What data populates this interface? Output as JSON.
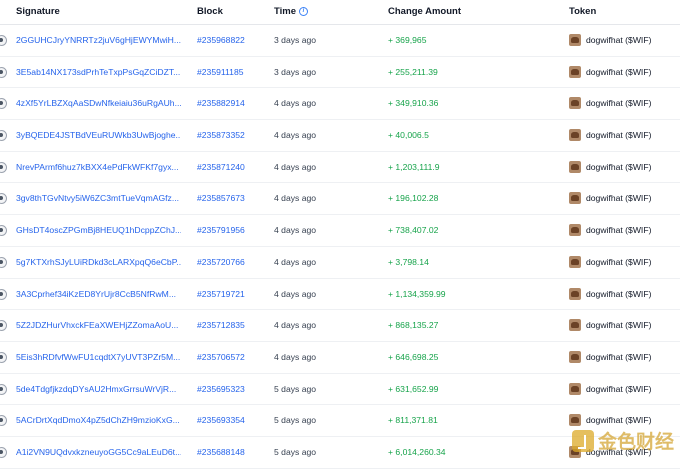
{
  "header": {
    "signature": "Signature",
    "block": "Block",
    "time": "Time",
    "change_amount": "Change Amount",
    "token": "Token"
  },
  "rows": [
    {
      "signature": "2GGUHCJryYNRRTz2juV6gHjEWYMwiH...",
      "block": "#235968822",
      "time": "3 days ago",
      "change": "+ 369,965",
      "token": "dogwifhat ($WIF)"
    },
    {
      "signature": "3E5ab14NX173sdPrhTeTxpPsGqZCiDZT...",
      "block": "#235911185",
      "time": "3 days ago",
      "change": "+ 255,211.39",
      "token": "dogwifhat ($WIF)"
    },
    {
      "signature": "4zXf5YrLBZXqAaSDwNfkeiaiu36uRgAUh...",
      "block": "#235882914",
      "time": "4 days ago",
      "change": "+ 349,910.36",
      "token": "dogwifhat ($WIF)"
    },
    {
      "signature": "3yBQEDE4JSTBdVEuRUWkb3UwBjoghe...",
      "block": "#235873352",
      "time": "4 days ago",
      "change": "+ 40,006.5",
      "token": "dogwifhat ($WIF)"
    },
    {
      "signature": "NrevPArmf6huz7kBXX4ePdFkWFKf7gyx...",
      "block": "#235871240",
      "time": "4 days ago",
      "change": "+ 1,203,111.9",
      "token": "dogwifhat ($WIF)"
    },
    {
      "signature": "3gv8thTGvNtvy5iW6ZC3mtTueVqmAGfz...",
      "block": "#235857673",
      "time": "4 days ago",
      "change": "+ 196,102.28",
      "token": "dogwifhat ($WIF)"
    },
    {
      "signature": "GHsDT4oscZPGmBj8HEUQ1hDcppZChJ...",
      "block": "#235791956",
      "time": "4 days ago",
      "change": "+ 738,407.02",
      "token": "dogwifhat ($WIF)"
    },
    {
      "signature": "5g7KTXrhSJyLUiRDkd3cLARXpqQ6eCbP...",
      "block": "#235720766",
      "time": "4 days ago",
      "change": "+ 3,798.14",
      "token": "dogwifhat ($WIF)"
    },
    {
      "signature": "3A3Cprhef34iKzED8YrUjr8CcB5NfRwM...",
      "block": "#235719721",
      "time": "4 days ago",
      "change": "+ 1,134,359.99",
      "token": "dogwifhat ($WIF)"
    },
    {
      "signature": "5Z2JDZHurVhxckFEaXWEHjZZomaAoU...",
      "block": "#235712835",
      "time": "4 days ago",
      "change": "+ 868,135.27",
      "token": "dogwifhat ($WIF)"
    },
    {
      "signature": "5Eis3hRDfvfWwFU1cqdtX7yUVT3PZr5M...",
      "block": "#235706572",
      "time": "4 days ago",
      "change": "+ 646,698.25",
      "token": "dogwifhat ($WIF)"
    },
    {
      "signature": "5de4TdgfjkzdqDYsAU2HmxGrrsuWrVjR...",
      "block": "#235695323",
      "time": "5 days ago",
      "change": "+ 631,652.99",
      "token": "dogwifhat ($WIF)"
    },
    {
      "signature": "5ACrDrtXqdDmoX4pZ5dChZH9mzioKxG...",
      "block": "#235693354",
      "time": "5 days ago",
      "change": "+ 811,371.81",
      "token": "dogwifhat ($WIF)"
    },
    {
      "signature": "A1i2VN9UQdvxkzneuyoGG5Cc9aLEuD6t...",
      "block": "#235688148",
      "time": "5 days ago",
      "change": "+ 6,014,260.34",
      "token": "dogwifhat ($WIF)"
    }
  ],
  "watermark": "金色财经",
  "colors": {
    "link": "#2563eb",
    "positive": "#16a34a"
  },
  "icons": {
    "row_view": "eye-icon",
    "time_info": "info-icon",
    "token": "dogwifhat-token-icon"
  }
}
